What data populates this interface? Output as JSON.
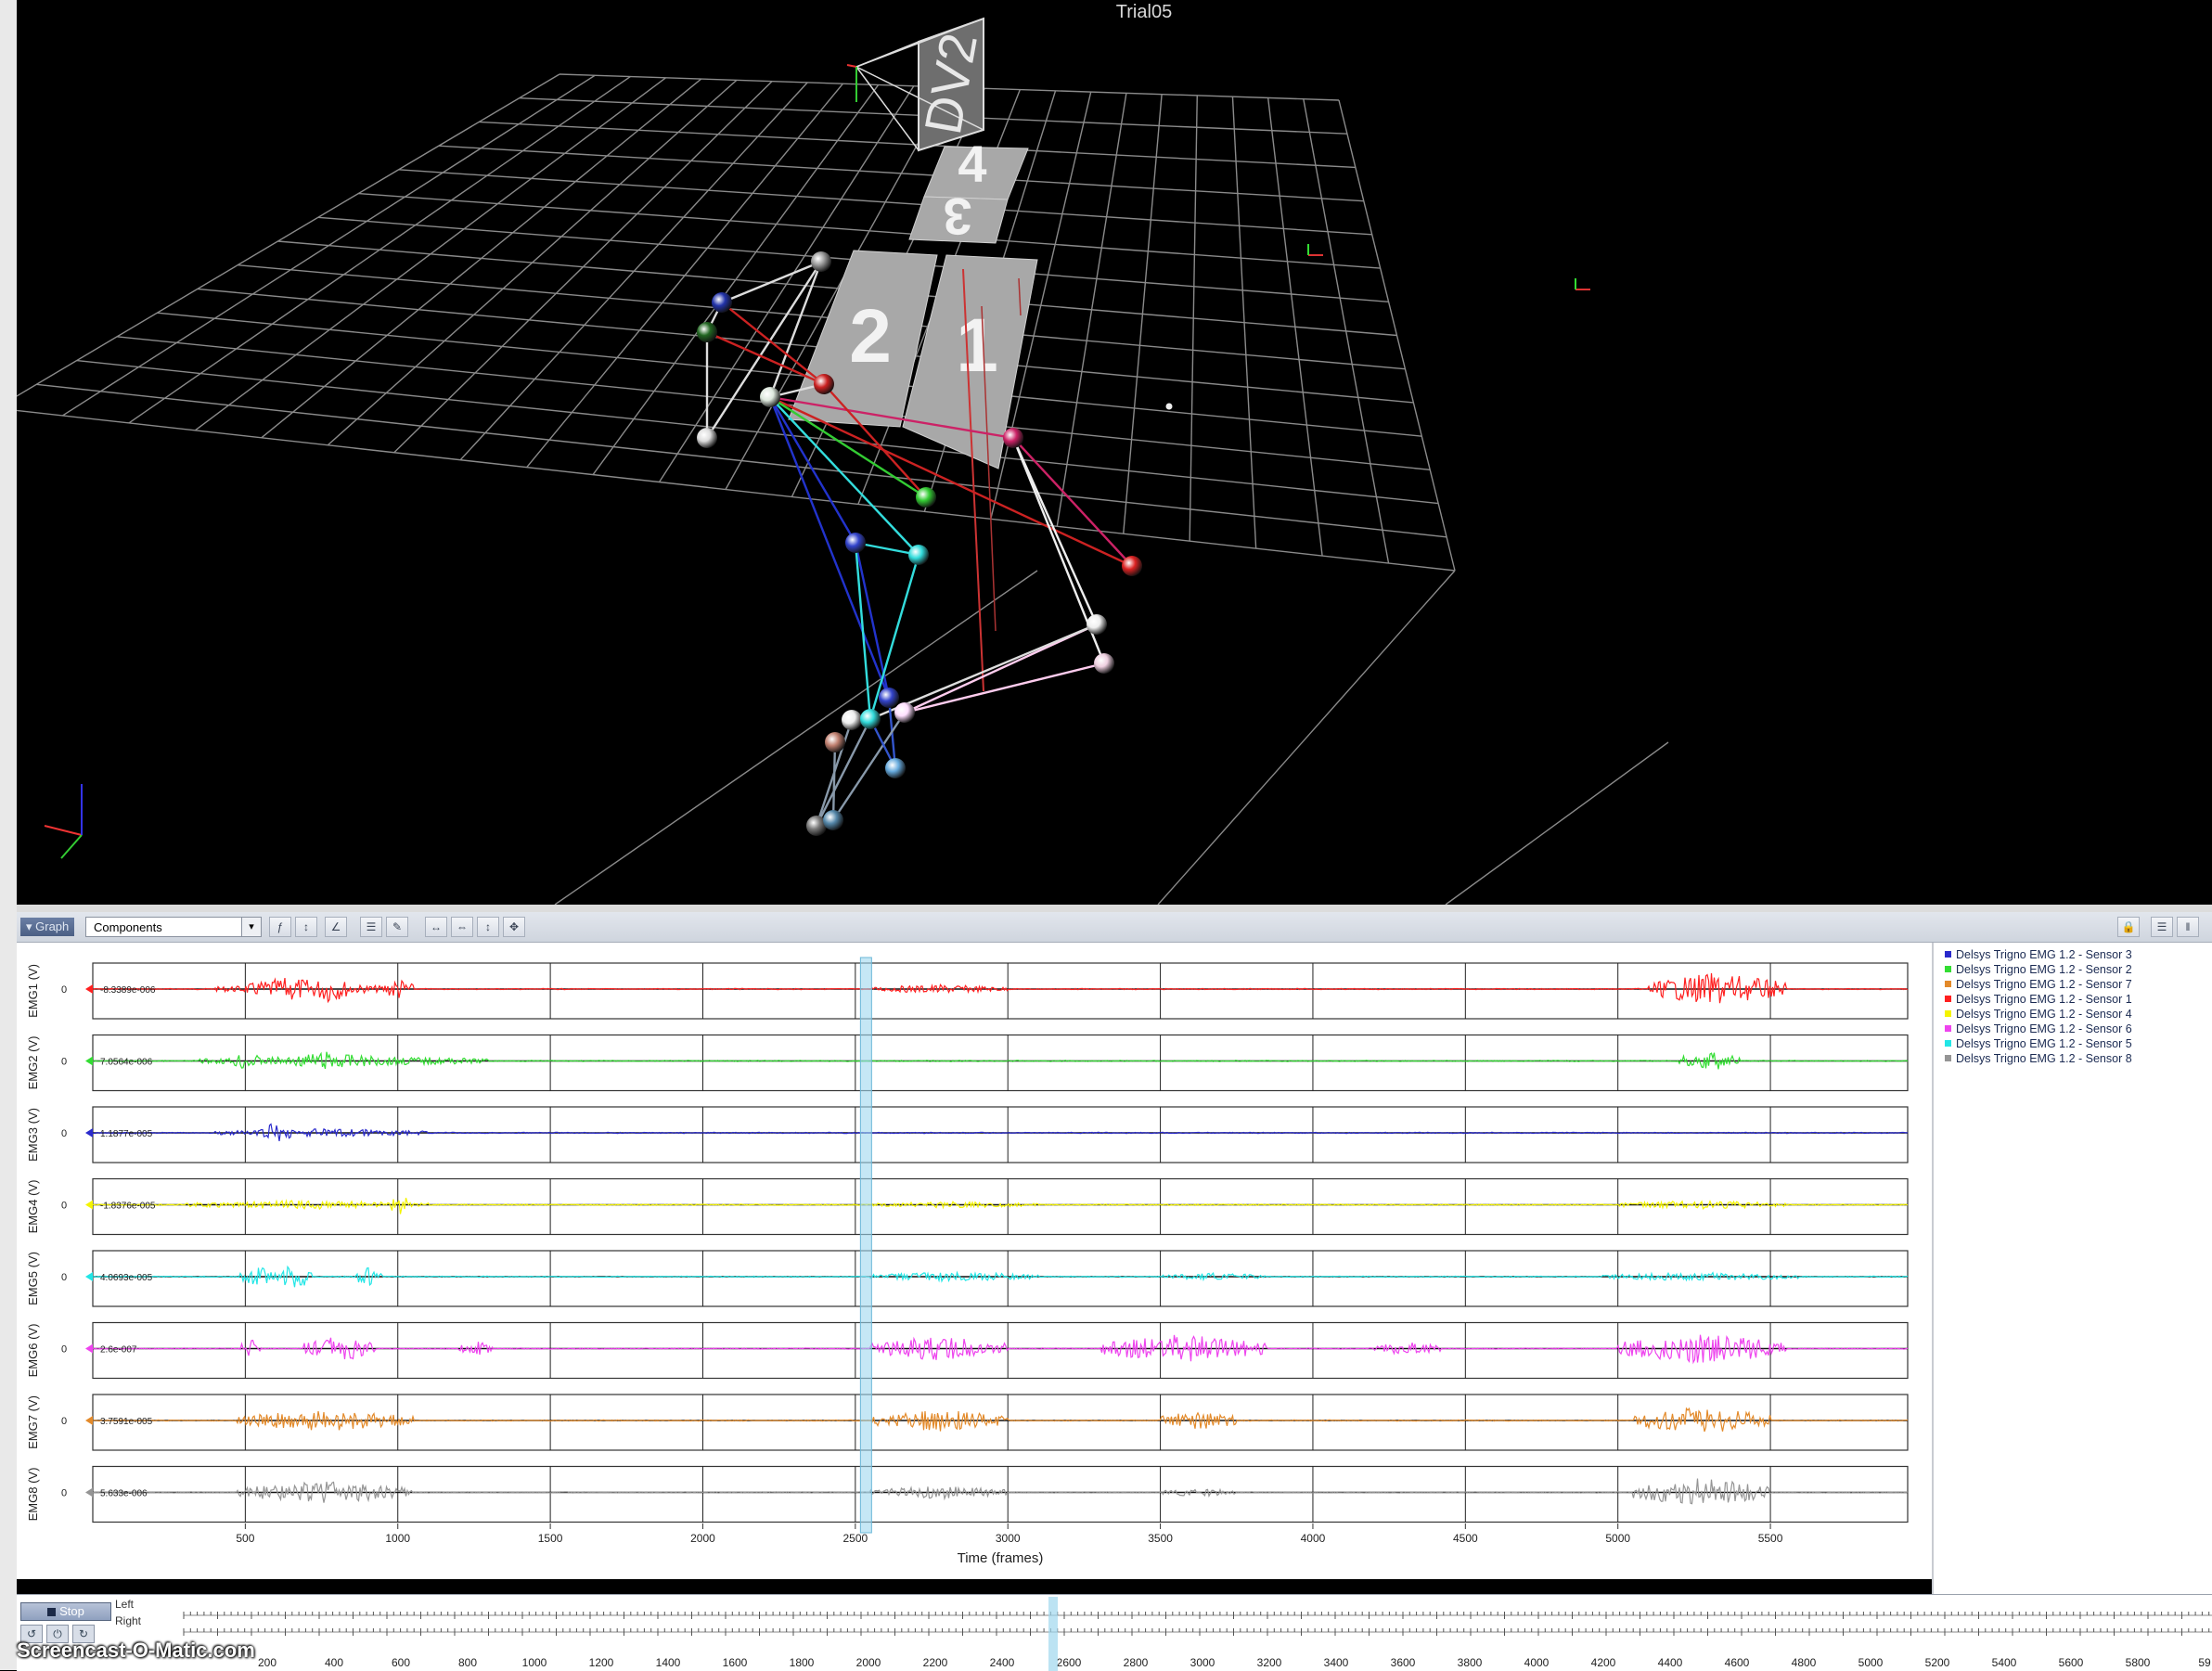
{
  "viewport": {
    "title": "Trial05",
    "camera_label": "DV2",
    "plate_labels": [
      "4",
      "3",
      "2",
      "1"
    ]
  },
  "graph_toolbar": {
    "tab_label": "Graph",
    "components_value": "Components"
  },
  "graph": {
    "x_label": "Time (frames)",
    "x_ticks": [
      "500",
      "1000",
      "1500",
      "2000",
      "2500",
      "3000",
      "3500",
      "4000",
      "4500",
      "5000",
      "5500"
    ],
    "cursor_frame": 2535,
    "rows": [
      {
        "label": "EMG1 (V)",
        "value": "-8.3389e-006",
        "color": "#ff2020",
        "zero": "0"
      },
      {
        "label": "EMG2 (V)",
        "value": "7.0564e-006",
        "color": "#33dd33",
        "zero": "0"
      },
      {
        "label": "EMG3 (V)",
        "value": "1.1877e-005",
        "color": "#2a2acc",
        "zero": "0"
      },
      {
        "label": "EMG4 (V)",
        "value": "-1.8376e-005",
        "color": "#f4f400",
        "zero": "0"
      },
      {
        "label": "EMG5 (V)",
        "value": "4.0693e-005",
        "color": "#22e6e6",
        "zero": "0"
      },
      {
        "label": "EMG6 (V)",
        "value": "2.6e-007",
        "color": "#ee44ee",
        "zero": "0"
      },
      {
        "label": "EMG7 (V)",
        "value": "3.7591e-005",
        "color": "#e38a2a",
        "zero": "0"
      },
      {
        "label": "EMG8 (V)",
        "value": "5.633e-006",
        "color": "#959595",
        "zero": "0"
      }
    ]
  },
  "legend": [
    {
      "label": "Delsys Trigno EMG 1.2 - Sensor 3",
      "color": "#2a2acc"
    },
    {
      "label": "Delsys Trigno EMG 1.2 - Sensor 2",
      "color": "#33dd33"
    },
    {
      "label": "Delsys Trigno EMG 1.2 - Sensor 7",
      "color": "#e38a2a"
    },
    {
      "label": "Delsys Trigno EMG 1.2 - Sensor 1",
      "color": "#ff2020"
    },
    {
      "label": "Delsys Trigno EMG 1.2 - Sensor 4",
      "color": "#f4f400"
    },
    {
      "label": "Delsys Trigno EMG 1.2 - Sensor 6",
      "color": "#ee44ee"
    },
    {
      "label": "Delsys Trigno EMG 1.2 - Sensor 5",
      "color": "#22e6e6"
    },
    {
      "label": "Delsys Trigno EMG 1.2 - Sensor 8",
      "color": "#959595"
    }
  ],
  "timeline": {
    "stop_label": "Stop",
    "left_label": "Left",
    "right_label": "Right",
    "ticks": [
      "200",
      "400",
      "600",
      "800",
      "1000",
      "1200",
      "1400",
      "1600",
      "1800",
      "2000",
      "2200",
      "2400",
      "2600",
      "2800",
      "3000",
      "3200",
      "3400",
      "3600",
      "3800",
      "4000",
      "4200",
      "4400",
      "4600",
      "4800",
      "5000",
      "5200",
      "5400",
      "5600",
      "5800",
      "59"
    ]
  },
  "watermark": "Screencast-O-Matic.com"
}
